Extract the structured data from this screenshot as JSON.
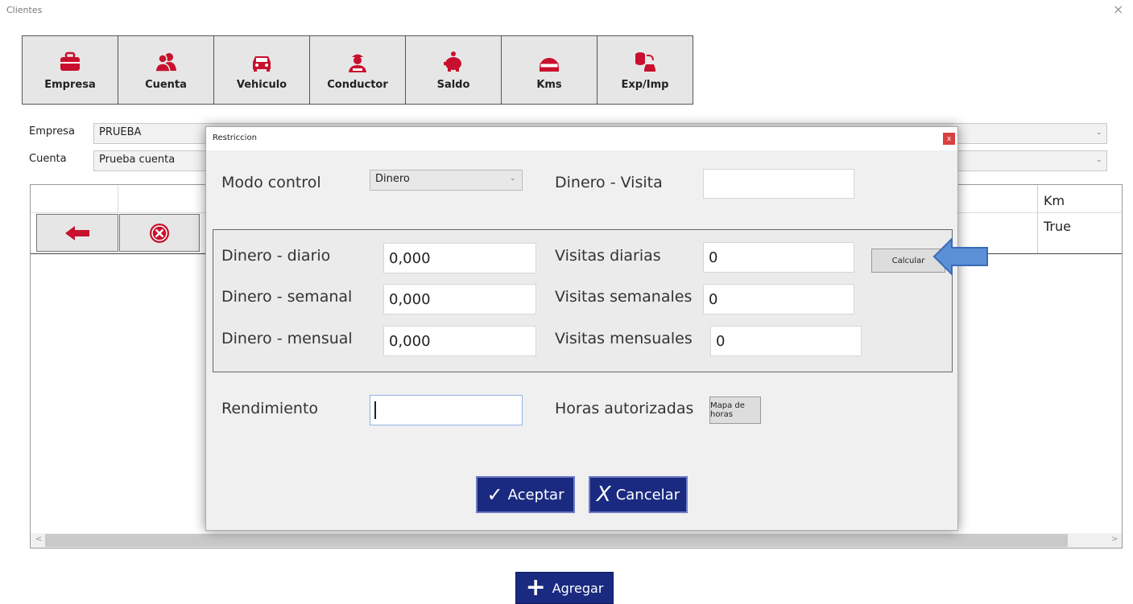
{
  "window": {
    "title": "Clientes",
    "close": "×"
  },
  "toolbar": [
    {
      "label": "Empresa",
      "icon": "briefcase-icon"
    },
    {
      "label": "Cuenta",
      "icon": "users-icon"
    },
    {
      "label": "Vehiculo",
      "icon": "car-icon"
    },
    {
      "label": "Conductor",
      "icon": "driver-icon"
    },
    {
      "label": "Saldo",
      "icon": "piggy-bank-icon"
    },
    {
      "label": "Kms",
      "icon": "odometer-icon"
    },
    {
      "label": "Exp/Imp",
      "icon": "database-car-icon"
    }
  ],
  "filters": {
    "empresa_label": "Empresa",
    "empresa_value": "PRUEBA",
    "cuenta_label": "Cuenta",
    "cuenta_value": "Prueba cuenta"
  },
  "grid": {
    "col_km": "Km",
    "cell_km": "True"
  },
  "add_button": "Agregar",
  "dialog": {
    "title": "Restriccion",
    "close": "x",
    "modo_control_label": "Modo control",
    "modo_control_value": "Dinero",
    "dinero_visita_label": "Dinero - Visita",
    "dinero_visita_value": "",
    "dinero_diario_label": "Dinero - diario",
    "dinero_diario_value": "0,000",
    "dinero_semanal_label": "Dinero - semanal",
    "dinero_semanal_value": "0,000",
    "dinero_mensual_label": "Dinero - mensual",
    "dinero_mensual_value": "0,000",
    "visitas_diarias_label": "Visitas diarias",
    "visitas_diarias_value": "0",
    "visitas_semanales_label": "Visitas semanales",
    "visitas_semanales_value": "0",
    "visitas_mensuales_label": "Visitas mensuales",
    "visitas_mensuales_value": "0",
    "calcular": "Calcular",
    "rendimiento_label": "Rendimiento",
    "rendimiento_value": "",
    "horas_label": "Horas autorizadas",
    "mapa_horas": "Mapa de horas",
    "aceptar": "Aceptar",
    "cancelar": "Cancelar"
  },
  "colors": {
    "icon_red": "#c8102e",
    "button_blue": "#1a2a80",
    "arrow_blue": "#5b8fd6"
  }
}
